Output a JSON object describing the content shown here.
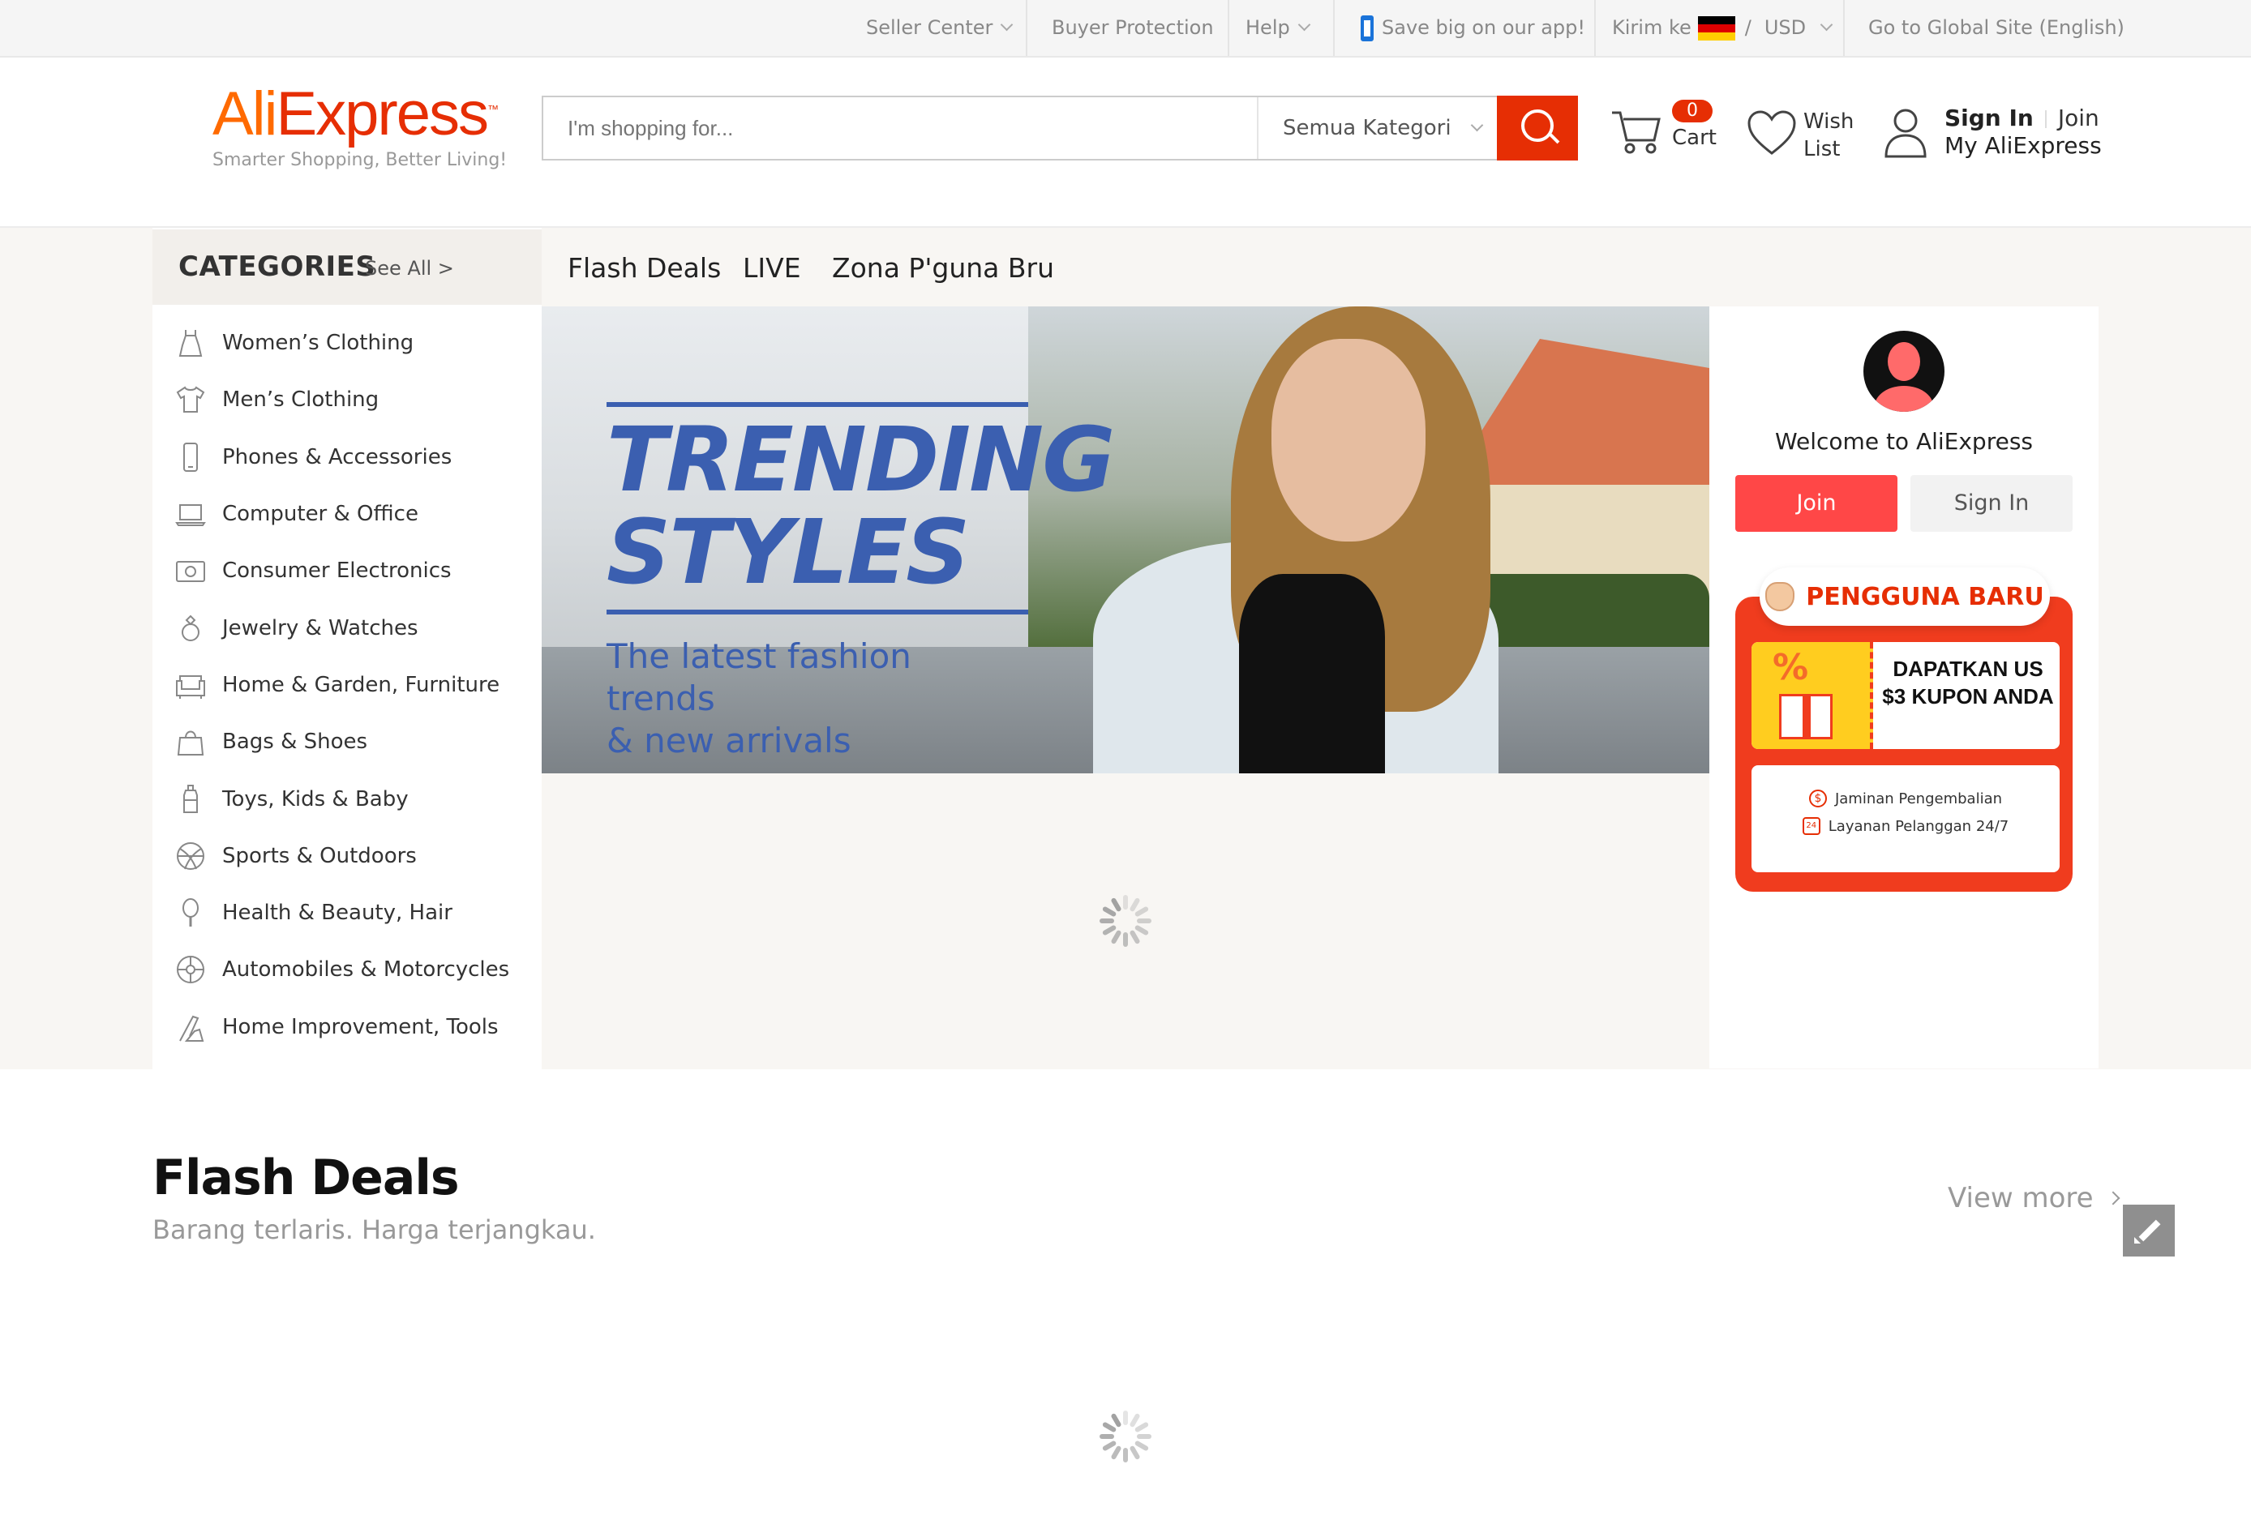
{
  "topbar": {
    "seller_center": "Seller Center",
    "buyer_protection": "Buyer Protection",
    "help": "Help",
    "app_promo": "Save big on our app!",
    "ship_to": "Kirim ke",
    "slash": "/",
    "currency": "USD",
    "global_site": "Go to Global Site (English)"
  },
  "header": {
    "logo_ali": "Ali",
    "logo_express": "Express",
    "logo_tm": "™",
    "tagline": "Smarter Shopping, Better Living!",
    "search_placeholder": "I'm shopping for...",
    "category_select": "Semua Kategori",
    "cart_count": "0",
    "cart_label": "Cart",
    "wish_label_1": "Wish",
    "wish_label_2": "List",
    "sign_in": "Sign In",
    "join": "Join",
    "my_account": "My AliExpress"
  },
  "categories": {
    "title": "CATEGORIES",
    "see_all": "See All >",
    "items": [
      {
        "label": "Women’s Clothing",
        "icon": "dress-icon"
      },
      {
        "label": "Men’s Clothing",
        "icon": "shirt-icon"
      },
      {
        "label": "Phones & Accessories",
        "icon": "phone-icon"
      },
      {
        "label": "Computer & Office",
        "icon": "laptop-icon"
      },
      {
        "label": "Consumer Electronics",
        "icon": "camera-icon"
      },
      {
        "label": "Jewelry & Watches",
        "icon": "ring-icon"
      },
      {
        "label": "Home & Garden, Furniture",
        "icon": "sofa-icon"
      },
      {
        "label": "Bags & Shoes",
        "icon": "bag-icon"
      },
      {
        "label": "Toys, Kids & Baby",
        "icon": "bottle-icon"
      },
      {
        "label": "Sports & Outdoors",
        "icon": "ball-icon"
      },
      {
        "label": "Health & Beauty, Hair",
        "icon": "mirror-icon"
      },
      {
        "label": "Automobiles & Motorcycles",
        "icon": "wheel-icon"
      },
      {
        "label": "Home Improvement, Tools",
        "icon": "tools-icon"
      }
    ]
  },
  "nav_tabs": [
    "Flash Deals",
    "LIVE",
    "Zona P'guna Bru"
  ],
  "banner": {
    "headline_1": "TRENDING",
    "headline_2": "STYLES",
    "subline_1": "The latest fashion trends",
    "subline_2": "& new arrivals"
  },
  "user_card": {
    "welcome": "Welcome to AliExpress",
    "join_button": "Join",
    "signin_button": "Sign In",
    "promo_title": "PENGGUNA BARU",
    "coupon_text": "DAPATKAN US $3 KUPON ANDA",
    "coupon_art": "%",
    "assurance_1": "Jaminan Pengembalian",
    "assurance_2": "Layanan Pelanggan 24/7",
    "assurance_1_icon": "$",
    "assurance_2_icon": "24"
  },
  "flash_deals": {
    "title": "Flash Deals",
    "subtitle": "Barang terlaris. Harga terjangkau.",
    "view_more": "View more"
  },
  "colors": {
    "brand_orange": "#ff6a00",
    "brand_red": "#e62e04",
    "join_red": "#ff4747",
    "banner_blue": "#3b5fb0"
  }
}
